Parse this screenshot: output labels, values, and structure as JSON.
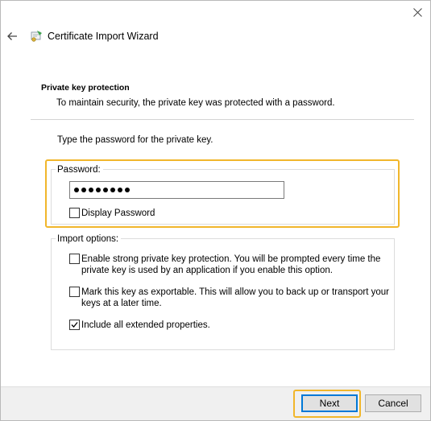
{
  "window": {
    "title": "Certificate Import Wizard"
  },
  "header": {
    "section_title": "Private key protection",
    "section_description": "To maintain security, the private key was protected with a password."
  },
  "body": {
    "instruction": "Type the password for the private key.",
    "password_group": {
      "legend": "Password:",
      "masked_value_length": 8,
      "display_password_label": "Display Password",
      "display_password_checked": false
    },
    "import_options": {
      "legend": "Import options:",
      "options": [
        {
          "line1": "Enable strong private key protection. You will be prompted every time the",
          "line2": "private key is used by an application if you enable this option.",
          "checked": false
        },
        {
          "line1": "Mark this key as exportable. This will allow you to back up or transport your",
          "line2": "keys at a later time.",
          "checked": false
        },
        {
          "line1": "Include all extended properties.",
          "line2": "",
          "checked": true
        }
      ]
    }
  },
  "footer": {
    "next_label": "Next",
    "cancel_label": "Cancel"
  },
  "colors": {
    "highlight": "#f1b62b",
    "focus_border": "#0078d7",
    "footer_bg": "#f0f0f0"
  },
  "icons": {
    "close": "close-icon",
    "back": "back-arrow-icon",
    "wizard": "certificate-icon",
    "check": "checkmark-icon"
  }
}
